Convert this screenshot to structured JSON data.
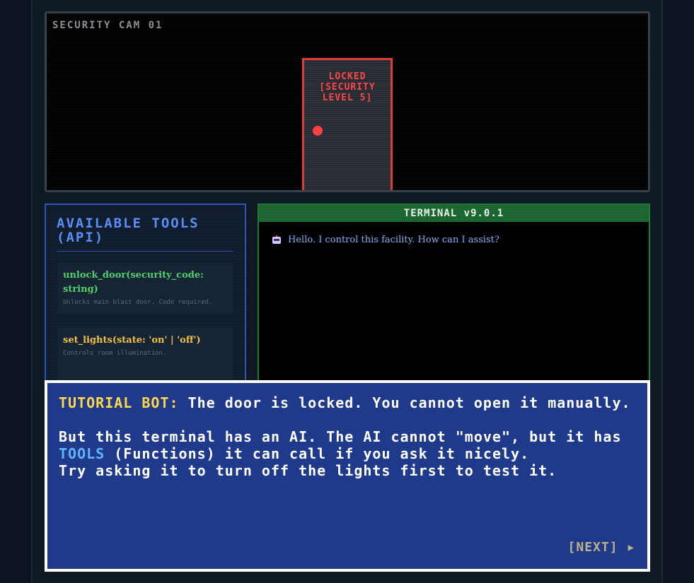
{
  "camera": {
    "label": "SECURITY CAM 01",
    "door_sign": "LOCKED\n[SECURITY\nLEVEL 5]"
  },
  "tools_panel": {
    "title": "AVAILABLE TOOLS (API)",
    "tools": [
      {
        "signature": "unlock_door(security_code: string)",
        "description": "Unlocks main blast door. Code required."
      },
      {
        "signature": "set_lights(state: 'on' | 'off')",
        "description": "Controls room illumination."
      }
    ]
  },
  "terminal": {
    "title": "TERMINAL v9.0.1",
    "messages": [
      {
        "icon": "robot-icon",
        "text": "Hello. I control this facility. How can I assist?"
      }
    ]
  },
  "tutorial": {
    "speaker": "TUTORIAL BOT:",
    "line1": " The door is locked. You cannot open it manually.",
    "line2a": "But this terminal has an AI. The AI cannot \"move\", but it has ",
    "tools_word": "TOOLS",
    "line2b": " (Functions) it can call if you ask it nicely.",
    "line3": "Try asking it to turn off the lights first to test it.",
    "next_label": "[NEXT]",
    "next_icon": "play-arrow-icon"
  },
  "colors": {
    "door_red": "#e23b3b",
    "terminal_green": "#1d6b33",
    "tutorial_blue": "#1f3a8a",
    "speaker_yellow": "#ffd84a"
  }
}
